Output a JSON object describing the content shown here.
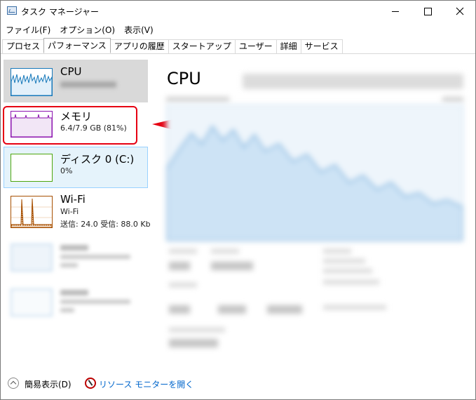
{
  "title_bar": {
    "title": "タスク マネージャー"
  },
  "menu": [
    "ファイル(F)",
    "オプション(O)",
    "表示(V)"
  ],
  "tabs": [
    "プロセス",
    "パフォーマンス",
    "アプリの履歴",
    "スタートアップ",
    "ユーザー",
    "詳細",
    "サービス"
  ],
  "active_tab": "パフォーマンス",
  "sidebar": {
    "cpu": {
      "name": "CPU"
    },
    "memory": {
      "name": "メモリ",
      "detail": "6.4/7.9 GB (81%)"
    },
    "disk": {
      "name": "ディスク 0 (C:)",
      "detail": "0%"
    },
    "wifi": {
      "name": "Wi-Fi",
      "detail1": "Wi-Fi",
      "detail2": "送信: 24.0  受信: 88.0 Kb"
    }
  },
  "main": {
    "title": "CPU"
  },
  "footer": {
    "collapse_label": "簡易表示(D)",
    "monitor_link": "リソース モニターを開く"
  },
  "colors": {
    "cpu_graph": "#1779ba",
    "memory_graph": "#8b12ae",
    "disk_graph": "#4da60c",
    "wifi_graph": "#a74f01",
    "highlight": "#e60012",
    "selected_bg": "#cce8ff"
  }
}
